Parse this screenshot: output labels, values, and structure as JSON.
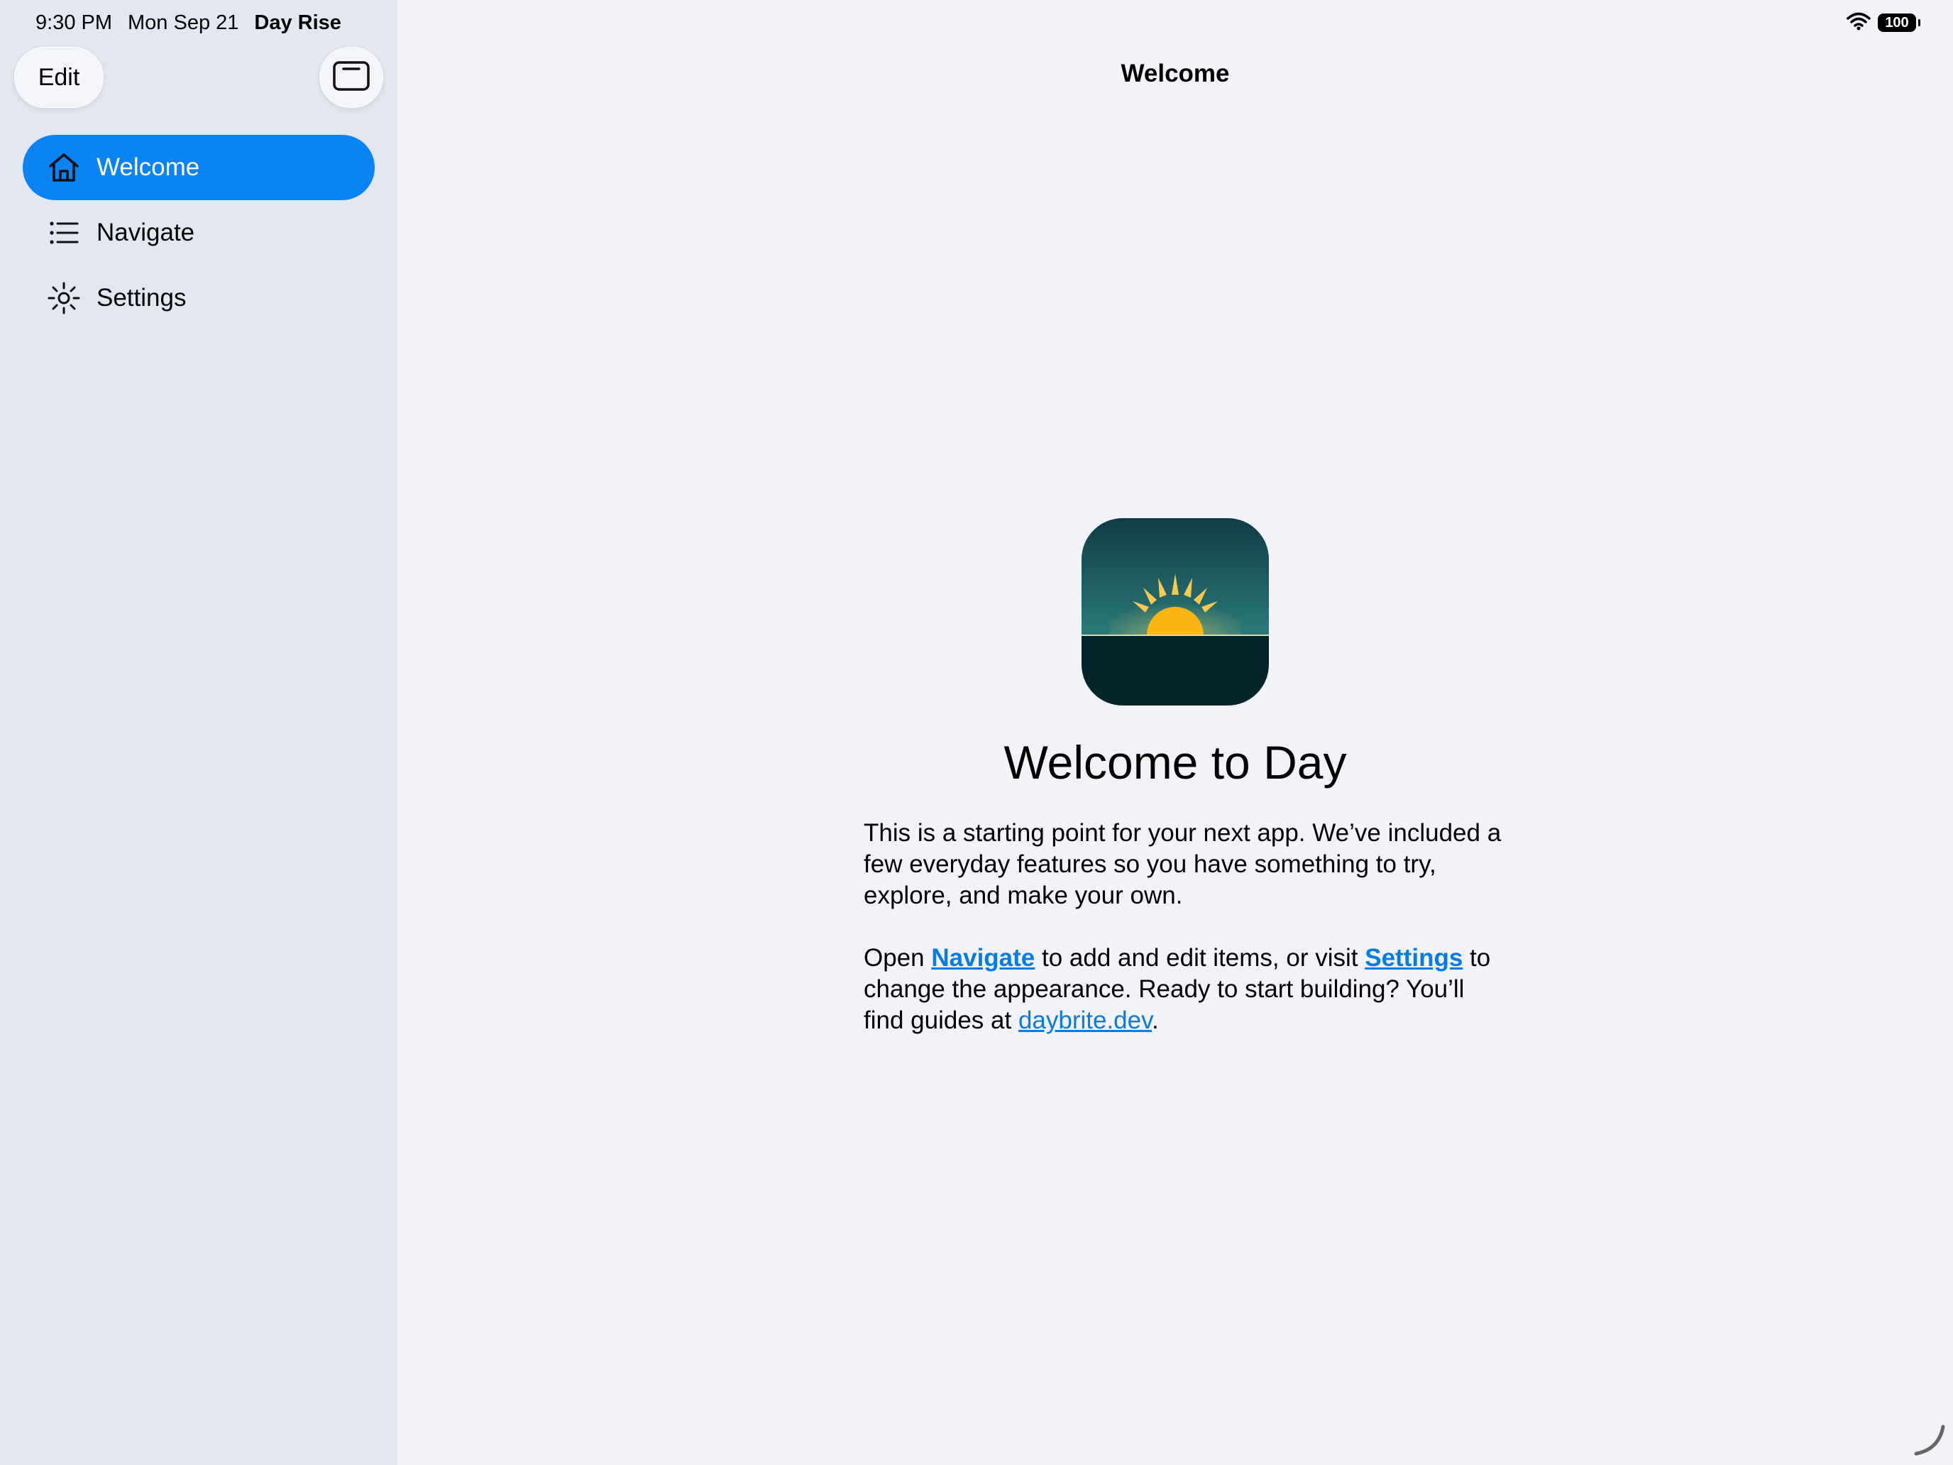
{
  "status_bar": {
    "time": "9:30 PM",
    "date": "Mon Sep 21",
    "app_name": "Day Rise",
    "battery": "100"
  },
  "sidebar": {
    "edit_label": "Edit",
    "items": [
      {
        "label": "Welcome",
        "icon": "house-icon",
        "selected": true
      },
      {
        "label": "Navigate",
        "icon": "list-icon",
        "selected": false
      },
      {
        "label": "Settings",
        "icon": "sun-icon",
        "selected": false
      }
    ]
  },
  "main": {
    "nav_title": "Welcome",
    "headline": "Welcome to Day",
    "paragraph1": "This is a starting point for your next app. We’ve included a few everyday features so you have something to try, explore, and make your own.",
    "p2_open": "Open ",
    "p2_navigate_link": "Navigate",
    "p2_mid": " to add and edit items, or visit ",
    "p2_settings_link": "Settings",
    "p2_after": " to change the appearance. Ready to start building? You’ll find guides at ",
    "p2_site_link": "daybrite.dev",
    "p2_end": "."
  },
  "colors": {
    "accent": "#0a84f5",
    "link": "#0a7be0",
    "sidebar_bg": "#e3e7f1",
    "main_bg": "#f2f3f8"
  }
}
